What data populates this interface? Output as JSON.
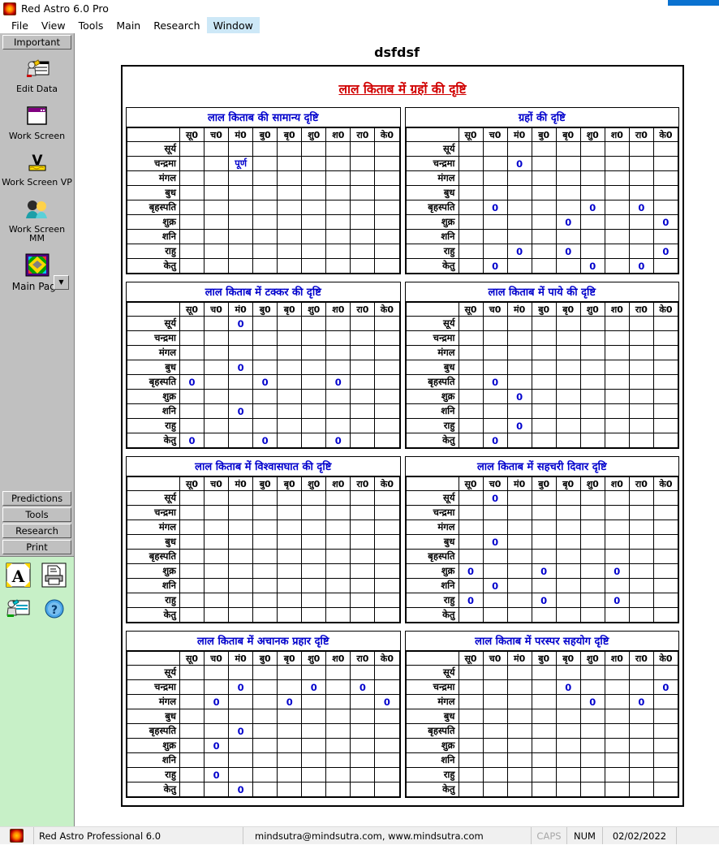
{
  "window": {
    "title": "Red Astro 6.0 Pro",
    "app_icon": "red-astro-logo-icon"
  },
  "menubar": {
    "items": [
      {
        "label": "File",
        "active": false
      },
      {
        "label": "View",
        "active": false
      },
      {
        "label": "Tools",
        "active": false
      },
      {
        "label": "Main",
        "active": false
      },
      {
        "label": "Research",
        "active": false
      },
      {
        "label": "Window",
        "active": true
      }
    ]
  },
  "sidebar": {
    "header_button": "Important",
    "icon_items": [
      {
        "label": "Edit Data",
        "icon": "edit-data-icon"
      },
      {
        "label": "Work Screen",
        "icon": "work-screen-window-icon"
      },
      {
        "label": "Work Screen VP",
        "icon": "work-screen-vp-icon"
      },
      {
        "label": "Work Screen MM",
        "icon": "work-screen-mm-people-icon"
      },
      {
        "label": "Main Page",
        "icon": "main-page-kundli-icon"
      }
    ],
    "buttons": [
      "Predictions",
      "Tools",
      "Research",
      "Print"
    ],
    "green_icons": [
      "font-A-icon",
      "print-icon",
      "edit-chart-icon",
      "help-question-icon"
    ]
  },
  "main": {
    "document_title": "dsfdsf",
    "sheet_heading": "लाल किताब में ग्रहों की दृष्टि",
    "row_labels": [
      "सूर्य",
      "चन्द्रमा",
      "मंगल",
      "बुध",
      "बृहस्पति",
      "शुक्र",
      "शनि",
      "राहु",
      "केतु"
    ],
    "column_headers": [
      "",
      "सू0",
      "च0",
      "मं0",
      "बु0",
      "बृ0",
      "शु0",
      "श0",
      "रा0",
      "के0"
    ],
    "tables": [
      {
        "title": "लाल किताब की सामान्य दृष्टि",
        "rows": [
          [
            "",
            "",
            "",
            "",
            "",
            "",
            "",
            "",
            ""
          ],
          [
            "",
            "",
            "पूर्ण",
            "",
            "",
            "",
            "",
            "",
            ""
          ],
          [
            "",
            "",
            "",
            "",
            "",
            "",
            "",
            "",
            ""
          ],
          [
            "",
            "",
            "",
            "",
            "",
            "",
            "",
            "",
            ""
          ],
          [
            "",
            "",
            "",
            "",
            "",
            "",
            "",
            "",
            ""
          ],
          [
            "",
            "",
            "",
            "",
            "",
            "",
            "",
            "",
            ""
          ],
          [
            "",
            "",
            "",
            "",
            "",
            "",
            "",
            "",
            ""
          ],
          [
            "",
            "",
            "",
            "",
            "",
            "",
            "",
            "",
            ""
          ],
          [
            "",
            "",
            "",
            "",
            "",
            "",
            "",
            "",
            ""
          ]
        ]
      },
      {
        "title": "ग्रहों की दृष्टि",
        "rows": [
          [
            "",
            "",
            "",
            "",
            "",
            "",
            "",
            "",
            ""
          ],
          [
            "",
            "",
            "0",
            "",
            "",
            "",
            "",
            "",
            ""
          ],
          [
            "",
            "",
            "",
            "",
            "",
            "",
            "",
            "",
            ""
          ],
          [
            "",
            "",
            "",
            "",
            "",
            "",
            "",
            "",
            ""
          ],
          [
            "",
            "0",
            "",
            "",
            "",
            "0",
            "",
            "0",
            ""
          ],
          [
            "",
            "",
            "",
            "",
            "0",
            "",
            "",
            "",
            "0"
          ],
          [
            "",
            "",
            "",
            "",
            "",
            "",
            "",
            "",
            ""
          ],
          [
            "",
            "",
            "0",
            "",
            "0",
            "",
            "",
            "",
            "0"
          ],
          [
            "",
            "0",
            "",
            "",
            "",
            "0",
            "",
            "0",
            ""
          ]
        ]
      },
      {
        "title": "लाल किताब में टक्कर की दृष्टि",
        "rows": [
          [
            "",
            "",
            "0",
            "",
            "",
            "",
            "",
            "",
            ""
          ],
          [
            "",
            "",
            "",
            "",
            "",
            "",
            "",
            "",
            ""
          ],
          [
            "",
            "",
            "",
            "",
            "",
            "",
            "",
            "",
            ""
          ],
          [
            "",
            "",
            "0",
            "",
            "",
            "",
            "",
            "",
            ""
          ],
          [
            "0",
            "",
            "",
            "0",
            "",
            "",
            "0",
            "",
            ""
          ],
          [
            "",
            "",
            "",
            "",
            "",
            "",
            "",
            "",
            ""
          ],
          [
            "",
            "",
            "0",
            "",
            "",
            "",
            "",
            "",
            ""
          ],
          [
            "",
            "",
            "",
            "",
            "",
            "",
            "",
            "",
            ""
          ],
          [
            "0",
            "",
            "",
            "0",
            "",
            "",
            "0",
            "",
            ""
          ]
        ]
      },
      {
        "title": "लाल किताब में पाये की दृष्टि",
        "rows": [
          [
            "",
            "",
            "",
            "",
            "",
            "",
            "",
            "",
            ""
          ],
          [
            "",
            "",
            "",
            "",
            "",
            "",
            "",
            "",
            ""
          ],
          [
            "",
            "",
            "",
            "",
            "",
            "",
            "",
            "",
            ""
          ],
          [
            "",
            "",
            "",
            "",
            "",
            "",
            "",
            "",
            ""
          ],
          [
            "",
            "0",
            "",
            "",
            "",
            "",
            "",
            "",
            ""
          ],
          [
            "",
            "",
            "0",
            "",
            "",
            "",
            "",
            "",
            ""
          ],
          [
            "",
            "",
            "",
            "",
            "",
            "",
            "",
            "",
            ""
          ],
          [
            "",
            "",
            "0",
            "",
            "",
            "",
            "",
            "",
            ""
          ],
          [
            "",
            "0",
            "",
            "",
            "",
            "",
            "",
            "",
            ""
          ]
        ]
      },
      {
        "title": "लाल किताब में विश्वासघात की दृष्टि",
        "rows": [
          [
            "",
            "",
            "",
            "",
            "",
            "",
            "",
            "",
            ""
          ],
          [
            "",
            "",
            "",
            "",
            "",
            "",
            "",
            "",
            ""
          ],
          [
            "",
            "",
            "",
            "",
            "",
            "",
            "",
            "",
            ""
          ],
          [
            "",
            "",
            "",
            "",
            "",
            "",
            "",
            "",
            ""
          ],
          [
            "",
            "",
            "",
            "",
            "",
            "",
            "",
            "",
            ""
          ],
          [
            "",
            "",
            "",
            "",
            "",
            "",
            "",
            "",
            ""
          ],
          [
            "",
            "",
            "",
            "",
            "",
            "",
            "",
            "",
            ""
          ],
          [
            "",
            "",
            "",
            "",
            "",
            "",
            "",
            "",
            ""
          ],
          [
            "",
            "",
            "",
            "",
            "",
            "",
            "",
            "",
            ""
          ]
        ]
      },
      {
        "title": "लाल किताब में सहचरी दिवार दृष्टि",
        "rows": [
          [
            "",
            "0",
            "",
            "",
            "",
            "",
            "",
            "",
            ""
          ],
          [
            "",
            "",
            "",
            "",
            "",
            "",
            "",
            "",
            ""
          ],
          [
            "",
            "",
            "",
            "",
            "",
            "",
            "",
            "",
            ""
          ],
          [
            "",
            "0",
            "",
            "",
            "",
            "",
            "",
            "",
            ""
          ],
          [
            "",
            "",
            "",
            "",
            "",
            "",
            "",
            "",
            ""
          ],
          [
            "0",
            "",
            "",
            "0",
            "",
            "",
            "0",
            "",
            ""
          ],
          [
            "",
            "0",
            "",
            "",
            "",
            "",
            "",
            "",
            ""
          ],
          [
            "0",
            "",
            "",
            "0",
            "",
            "",
            "0",
            "",
            ""
          ],
          [
            "",
            "",
            "",
            "",
            "",
            "",
            "",
            "",
            ""
          ]
        ]
      },
      {
        "title": "लाल किताब में अचानक प्रहार दृष्टि",
        "rows": [
          [
            "",
            "",
            "",
            "",
            "",
            "",
            "",
            "",
            ""
          ],
          [
            "",
            "",
            "0",
            "",
            "",
            "0",
            "",
            "0",
            ""
          ],
          [
            "",
            "0",
            "",
            "",
            "0",
            "",
            "",
            "",
            "0"
          ],
          [
            "",
            "",
            "",
            "",
            "",
            "",
            "",
            "",
            ""
          ],
          [
            "",
            "",
            "0",
            "",
            "",
            "",
            "",
            "",
            ""
          ],
          [
            "",
            "0",
            "",
            "",
            "",
            "",
            "",
            "",
            ""
          ],
          [
            "",
            "",
            "",
            "",
            "",
            "",
            "",
            "",
            ""
          ],
          [
            "",
            "0",
            "",
            "",
            "",
            "",
            "",
            "",
            ""
          ],
          [
            "",
            "",
            "0",
            "",
            "",
            "",
            "",
            "",
            ""
          ]
        ]
      },
      {
        "title": "लाल किताब में परस्पर सहयोग दृष्टि",
        "rows": [
          [
            "",
            "",
            "",
            "",
            "",
            "",
            "",
            "",
            ""
          ],
          [
            "",
            "",
            "",
            "",
            "0",
            "",
            "",
            "",
            "0"
          ],
          [
            "",
            "",
            "",
            "",
            "",
            "0",
            "",
            "0",
            ""
          ],
          [
            "",
            "",
            "",
            "",
            "",
            "",
            "",
            "",
            ""
          ],
          [
            "",
            "",
            "",
            "",
            "",
            "",
            "",
            "",
            ""
          ],
          [
            "",
            "",
            "",
            "",
            "",
            "",
            "",
            "",
            ""
          ],
          [
            "",
            "",
            "",
            "",
            "",
            "",
            "",
            "",
            ""
          ],
          [
            "",
            "",
            "",
            "",
            "",
            "",
            "",
            "",
            ""
          ],
          [
            "",
            "",
            "",
            "",
            "",
            "",
            "",
            "",
            ""
          ]
        ]
      }
    ]
  },
  "statusbar": {
    "app_name": "Red Astro Professional 6.0",
    "contact": "mindsutra@mindsutra.com, www.mindsutra.com",
    "caps": "CAPS",
    "num": "NUM",
    "date": "02/02/2022"
  },
  "colors": {
    "heading_red": "#d00000",
    "table_title_blue": "#0000cc",
    "mark_blue": "#0000cc",
    "sidebar_gray": "#c0c0c0",
    "green_panel": "#c7f0c7",
    "menu_active": "#cde8f7"
  }
}
